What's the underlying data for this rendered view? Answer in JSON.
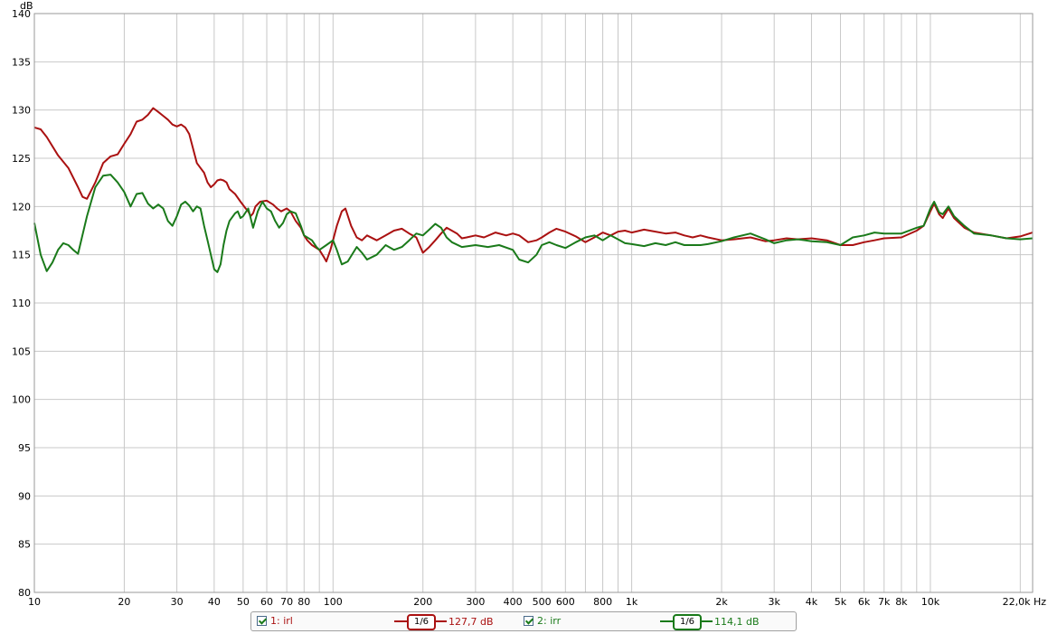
{
  "chart_data": {
    "type": "line",
    "ylabel": "dB",
    "xunit": "Hz",
    "xscale": "log",
    "xlim": [
      10,
      22000
    ],
    "ylim": [
      80,
      140
    ],
    "yticks": [
      80,
      85,
      90,
      95,
      100,
      105,
      110,
      115,
      120,
      125,
      130,
      135,
      140
    ],
    "xtick_labels": [
      {
        "v": 10,
        "label": "10"
      },
      {
        "v": 20,
        "label": "20"
      },
      {
        "v": 30,
        "label": "30"
      },
      {
        "v": 40,
        "label": "40"
      },
      {
        "v": 50,
        "label": "50"
      },
      {
        "v": 60,
        "label": "60"
      },
      {
        "v": 70,
        "label": "70"
      },
      {
        "v": 80,
        "label": "80"
      },
      {
        "v": 100,
        "label": "100"
      },
      {
        "v": 200,
        "label": "200"
      },
      {
        "v": 300,
        "label": "300"
      },
      {
        "v": 400,
        "label": "400"
      },
      {
        "v": 500,
        "label": "500"
      },
      {
        "v": 600,
        "label": "600"
      },
      {
        "v": 800,
        "label": "800"
      },
      {
        "v": 1000,
        "label": "1k"
      },
      {
        "v": 2000,
        "label": "2k"
      },
      {
        "v": 3000,
        "label": "3k"
      },
      {
        "v": 4000,
        "label": "4k"
      },
      {
        "v": 5000,
        "label": "5k"
      },
      {
        "v": 6000,
        "label": "6k"
      },
      {
        "v": 7000,
        "label": "7k"
      },
      {
        "v": 8000,
        "label": "8k"
      },
      {
        "v": 10000,
        "label": "10k"
      },
      {
        "v": 22000,
        "label": "22,0k Hz"
      }
    ],
    "grid": true,
    "colors": {
      "grid": "#c8c8c8",
      "background": "#ffffff"
    },
    "series": [
      {
        "name": "1: irl",
        "color": "#aa1111",
        "smoothing": "1/6",
        "level": "127,7 dB",
        "points": [
          [
            10,
            128.2
          ],
          [
            10.5,
            128
          ],
          [
            11,
            127.2
          ],
          [
            12,
            125.3
          ],
          [
            13,
            124
          ],
          [
            14,
            122
          ],
          [
            14.5,
            121
          ],
          [
            15,
            120.8
          ],
          [
            16,
            122.5
          ],
          [
            17,
            124.5
          ],
          [
            18,
            125.2
          ],
          [
            19,
            125.4
          ],
          [
            20,
            126.5
          ],
          [
            21,
            127.5
          ],
          [
            22,
            128.8
          ],
          [
            23,
            129
          ],
          [
            24,
            129.5
          ],
          [
            25,
            130.2
          ],
          [
            26,
            129.8
          ],
          [
            27,
            129.4
          ],
          [
            28,
            129
          ],
          [
            29,
            128.5
          ],
          [
            30,
            128.3
          ],
          [
            31,
            128.5
          ],
          [
            32,
            128.2
          ],
          [
            33,
            127.5
          ],
          [
            34,
            126
          ],
          [
            35,
            124.5
          ],
          [
            36,
            124
          ],
          [
            37,
            123.5
          ],
          [
            38,
            122.5
          ],
          [
            39,
            122
          ],
          [
            40,
            122.3
          ],
          [
            41,
            122.7
          ],
          [
            42,
            122.8
          ],
          [
            43,
            122.7
          ],
          [
            44,
            122.5
          ],
          [
            45,
            121.8
          ],
          [
            47,
            121.3
          ],
          [
            49,
            120.5
          ],
          [
            51,
            119.8
          ],
          [
            52,
            119.5
          ],
          [
            53,
            119
          ],
          [
            54,
            119.3
          ],
          [
            55,
            120
          ],
          [
            57,
            120.5
          ],
          [
            60,
            120.6
          ],
          [
            63,
            120.2
          ],
          [
            65,
            119.8
          ],
          [
            67,
            119.5
          ],
          [
            70,
            119.8
          ],
          [
            72,
            119.5
          ],
          [
            75,
            118.5
          ],
          [
            78,
            117.8
          ],
          [
            80,
            117
          ],
          [
            82,
            116.5
          ],
          [
            85,
            116
          ],
          [
            87,
            115.8
          ],
          [
            90,
            115.5
          ],
          [
            93,
            114.8
          ],
          [
            95,
            114.3
          ],
          [
            98,
            115.5
          ],
          [
            100,
            116.5
          ],
          [
            103,
            118
          ],
          [
            107,
            119.5
          ],
          [
            110,
            119.8
          ],
          [
            115,
            118
          ],
          [
            120,
            116.8
          ],
          [
            125,
            116.5
          ],
          [
            130,
            117
          ],
          [
            140,
            116.5
          ],
          [
            150,
            117
          ],
          [
            160,
            117.5
          ],
          [
            170,
            117.7
          ],
          [
            180,
            117.2
          ],
          [
            190,
            116.8
          ],
          [
            200,
            115.2
          ],
          [
            210,
            115.8
          ],
          [
            220,
            116.5
          ],
          [
            230,
            117.2
          ],
          [
            240,
            117.8
          ],
          [
            250,
            117.5
          ],
          [
            260,
            117.2
          ],
          [
            270,
            116.7
          ],
          [
            280,
            116.8
          ],
          [
            300,
            117
          ],
          [
            320,
            116.8
          ],
          [
            350,
            117.3
          ],
          [
            380,
            117
          ],
          [
            400,
            117.2
          ],
          [
            420,
            117
          ],
          [
            450,
            116.3
          ],
          [
            480,
            116.5
          ],
          [
            500,
            116.8
          ],
          [
            530,
            117.3
          ],
          [
            560,
            117.7
          ],
          [
            600,
            117.4
          ],
          [
            650,
            116.9
          ],
          [
            700,
            116.3
          ],
          [
            750,
            116.8
          ],
          [
            800,
            117.3
          ],
          [
            850,
            117
          ],
          [
            900,
            117.4
          ],
          [
            950,
            117.5
          ],
          [
            1000,
            117.3
          ],
          [
            1100,
            117.6
          ],
          [
            1200,
            117.4
          ],
          [
            1300,
            117.2
          ],
          [
            1400,
            117.3
          ],
          [
            1500,
            117
          ],
          [
            1600,
            116.8
          ],
          [
            1700,
            117
          ],
          [
            1800,
            116.8
          ],
          [
            2000,
            116.5
          ],
          [
            2200,
            116.6
          ],
          [
            2500,
            116.8
          ],
          [
            2800,
            116.4
          ],
          [
            3000,
            116.5
          ],
          [
            3300,
            116.7
          ],
          [
            3600,
            116.6
          ],
          [
            4000,
            116.7
          ],
          [
            4500,
            116.5
          ],
          [
            5000,
            116
          ],
          [
            5500,
            116
          ],
          [
            6000,
            116.3
          ],
          [
            6500,
            116.5
          ],
          [
            7000,
            116.7
          ],
          [
            8000,
            116.8
          ],
          [
            9000,
            117.5
          ],
          [
            9500,
            118
          ],
          [
            10000,
            119.5
          ],
          [
            10300,
            120.3
          ],
          [
            10700,
            119.2
          ],
          [
            11000,
            118.8
          ],
          [
            11500,
            119.8
          ],
          [
            12000,
            118.8
          ],
          [
            13000,
            117.8
          ],
          [
            14000,
            117.3
          ],
          [
            16000,
            117
          ],
          [
            18000,
            116.7
          ],
          [
            20000,
            116.9
          ],
          [
            22000,
            117.3
          ]
        ]
      },
      {
        "name": "2: irr",
        "color": "#1a7a1a",
        "smoothing": "1/6",
        "level": "114,1 dB",
        "points": [
          [
            10,
            118.3
          ],
          [
            10.5,
            115
          ],
          [
            11,
            113.3
          ],
          [
            11.5,
            114.2
          ],
          [
            12,
            115.5
          ],
          [
            12.5,
            116.2
          ],
          [
            13,
            116
          ],
          [
            13.5,
            115.5
          ],
          [
            14,
            115.1
          ],
          [
            15,
            119
          ],
          [
            16,
            122
          ],
          [
            17,
            123.2
          ],
          [
            18,
            123.3
          ],
          [
            19,
            122.5
          ],
          [
            20,
            121.5
          ],
          [
            21,
            120
          ],
          [
            22,
            121.3
          ],
          [
            23,
            121.4
          ],
          [
            24,
            120.3
          ],
          [
            25,
            119.8
          ],
          [
            26,
            120.2
          ],
          [
            27,
            119.8
          ],
          [
            28,
            118.5
          ],
          [
            29,
            118
          ],
          [
            30,
            119
          ],
          [
            31,
            120.2
          ],
          [
            32,
            120.5
          ],
          [
            33,
            120.1
          ],
          [
            34,
            119.5
          ],
          [
            35,
            120
          ],
          [
            36,
            119.8
          ],
          [
            37,
            118
          ],
          [
            38,
            116.5
          ],
          [
            39,
            115
          ],
          [
            40,
            113.5
          ],
          [
            41,
            113.2
          ],
          [
            42,
            114
          ],
          [
            43,
            116
          ],
          [
            44,
            117.5
          ],
          [
            45,
            118.5
          ],
          [
            47,
            119.3
          ],
          [
            48,
            119.5
          ],
          [
            49,
            118.8
          ],
          [
            50,
            119
          ],
          [
            52,
            119.8
          ],
          [
            53,
            118.8
          ],
          [
            54,
            117.8
          ],
          [
            56,
            119.5
          ],
          [
            58,
            120.5
          ],
          [
            60,
            119.8
          ],
          [
            62,
            119.5
          ],
          [
            64,
            118.5
          ],
          [
            66,
            117.8
          ],
          [
            68,
            118.3
          ],
          [
            70,
            119.2
          ],
          [
            72,
            119.5
          ],
          [
            75,
            119.3
          ],
          [
            78,
            118
          ],
          [
            80,
            117
          ],
          [
            85,
            116.5
          ],
          [
            88,
            115.8
          ],
          [
            90,
            115.5
          ],
          [
            95,
            116
          ],
          [
            100,
            116.5
          ],
          [
            103,
            115.5
          ],
          [
            107,
            114
          ],
          [
            112,
            114.3
          ],
          [
            120,
            115.8
          ],
          [
            125,
            115.2
          ],
          [
            130,
            114.5
          ],
          [
            140,
            115
          ],
          [
            150,
            116
          ],
          [
            160,
            115.5
          ],
          [
            170,
            115.8
          ],
          [
            180,
            116.5
          ],
          [
            190,
            117.2
          ],
          [
            200,
            117
          ],
          [
            210,
            117.6
          ],
          [
            220,
            118.2
          ],
          [
            230,
            117.8
          ],
          [
            240,
            116.8
          ],
          [
            250,
            116.3
          ],
          [
            270,
            115.8
          ],
          [
            300,
            116
          ],
          [
            330,
            115.8
          ],
          [
            360,
            116
          ],
          [
            400,
            115.5
          ],
          [
            420,
            114.5
          ],
          [
            450,
            114.2
          ],
          [
            480,
            115
          ],
          [
            500,
            116
          ],
          [
            530,
            116.3
          ],
          [
            560,
            116
          ],
          [
            600,
            115.7
          ],
          [
            650,
            116.3
          ],
          [
            700,
            116.8
          ],
          [
            750,
            117
          ],
          [
            800,
            116.5
          ],
          [
            850,
            117
          ],
          [
            900,
            116.6
          ],
          [
            950,
            116.2
          ],
          [
            1000,
            116.1
          ],
          [
            1100,
            115.9
          ],
          [
            1200,
            116.2
          ],
          [
            1300,
            116
          ],
          [
            1400,
            116.3
          ],
          [
            1500,
            116
          ],
          [
            1700,
            116
          ],
          [
            1800,
            116.1
          ],
          [
            2000,
            116.4
          ],
          [
            2200,
            116.8
          ],
          [
            2500,
            117.2
          ],
          [
            2800,
            116.6
          ],
          [
            3000,
            116.2
          ],
          [
            3300,
            116.5
          ],
          [
            3600,
            116.6
          ],
          [
            4000,
            116.4
          ],
          [
            4500,
            116.3
          ],
          [
            5000,
            116
          ],
          [
            5500,
            116.8
          ],
          [
            6000,
            117
          ],
          [
            6500,
            117.3
          ],
          [
            7000,
            117.2
          ],
          [
            8000,
            117.2
          ],
          [
            9000,
            117.8
          ],
          [
            9500,
            118
          ],
          [
            10000,
            119.8
          ],
          [
            10300,
            120.5
          ],
          [
            10700,
            119.4
          ],
          [
            11000,
            119.2
          ],
          [
            11500,
            120
          ],
          [
            12000,
            119
          ],
          [
            13000,
            118
          ],
          [
            14000,
            117.2
          ],
          [
            16000,
            117
          ],
          [
            18000,
            116.7
          ],
          [
            20000,
            116.6
          ],
          [
            22000,
            116.7
          ]
        ]
      }
    ]
  },
  "legend": {
    "series1": {
      "checkbox": true,
      "label": "1: irl",
      "smoothing": "1/6",
      "level": "127,7 dB"
    },
    "series2": {
      "checkbox": true,
      "label": "2: irr",
      "smoothing": "1/6",
      "level": "114,1 dB"
    }
  }
}
